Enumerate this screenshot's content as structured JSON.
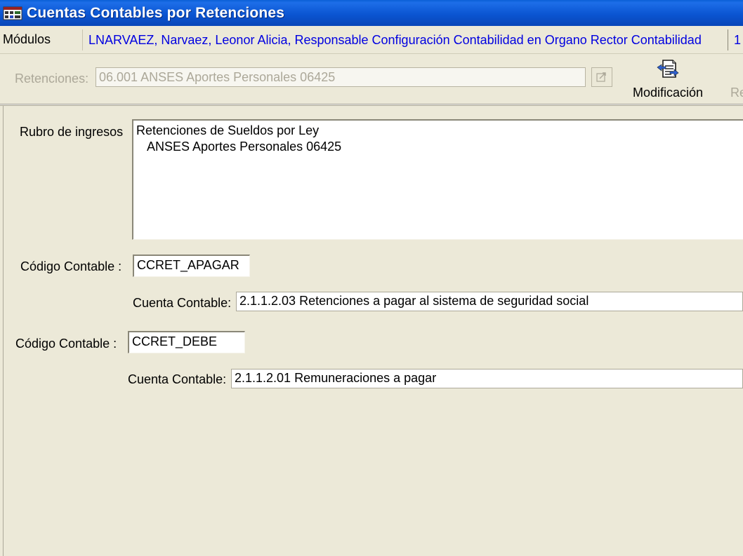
{
  "window": {
    "title": "Cuentas Contables por Retenciones"
  },
  "menubar": {
    "modulos": "Módulos",
    "user_info": "LNARVAEZ, Narvaez, Leonor Alicia, Responsable Configuración Contabilidad en Organo Rector Contabilidad",
    "extra": "1"
  },
  "toolbar": {
    "retenciones_label": "Retenciones:",
    "retenciones_value": "06.001 ANSES Aportes Personales 06425",
    "modificacion_label": "Modificación",
    "next_partial_label": "Re"
  },
  "form": {
    "rubro_label": "Rubro de ingresos",
    "rubro_lines": [
      "Retenciones de Sueldos por Ley",
      "ANSES Aportes Personales 06425"
    ],
    "block1": {
      "codigo_label": "Código Contable :",
      "codigo_value": "CCRET_APAGAR",
      "cuenta_label": "Cuenta Contable:",
      "cuenta_value": "2.1.1.2.03 Retenciones a pagar al sistema de seguridad social"
    },
    "block2": {
      "codigo_label": "Código Contable :",
      "codigo_value": "CCRET_DEBE",
      "cuenta_label": "Cuenta Contable:",
      "cuenta_value": "2.1.1.2.01 Remuneraciones a pagar"
    }
  },
  "colors": {
    "titlebar": "#0b55d2",
    "user_info_text": "#0000e0",
    "window_bg": "#ece9d8",
    "disabled_text": "#aca899"
  },
  "icons": {
    "title": "app-icon",
    "lookup": "lookup-arrow-icon",
    "modificacion": "document-edit-icon"
  }
}
